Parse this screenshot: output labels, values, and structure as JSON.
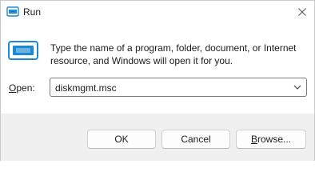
{
  "window": {
    "title": "Run",
    "icon": "run-app-icon",
    "close_icon": "close-icon"
  },
  "content": {
    "description": "Type the name of a program, folder, document, or Internet resource, and Windows will open it for you.",
    "open_label_accel": "O",
    "open_label_rest": "pen:",
    "open_value": "diskmgmt.msc",
    "dropdown_icon": "chevron-down-icon"
  },
  "buttons": {
    "ok_label": "OK",
    "cancel_label": "Cancel",
    "browse_label_accel": "B",
    "browse_label_rest": "rowse..."
  },
  "colors": {
    "accent_blue": "#1a8ad4",
    "footer_bg": "#f0f0f0"
  }
}
